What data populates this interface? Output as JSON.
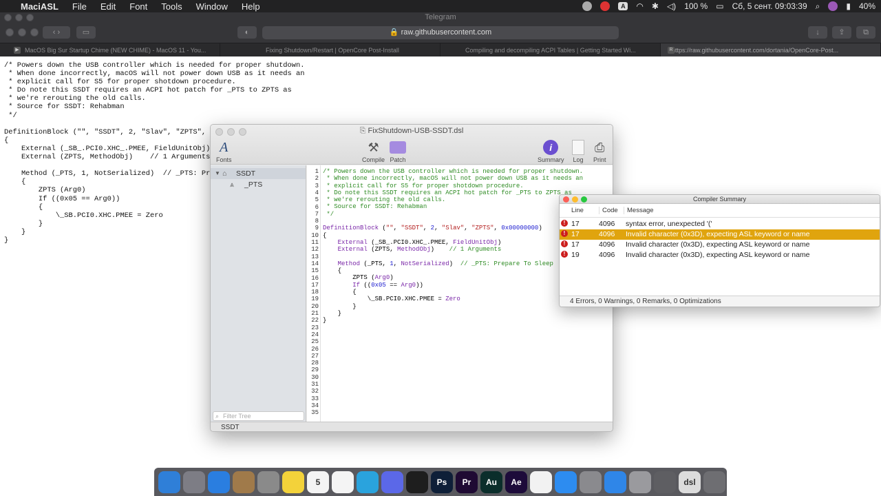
{
  "menubar": {
    "app": "MaciASL",
    "items": [
      "File",
      "Edit",
      "Font",
      "Tools",
      "Window",
      "Help"
    ],
    "battery": "100 %",
    "datetime": "Сб, 5 сент.  09:03:39",
    "battery2": "40%",
    "notif_badge": "A"
  },
  "browser": {
    "window_title": "Telegram",
    "url": "raw.githubusercontent.com",
    "tabs": [
      "MacOS Big Sur Startup Chime (NEW CHIME) - MacOS 11 - You...",
      "Fixing Shutdown/Restart | OpenCore Post-Install",
      "Compiling and decompiling ACPI Tables | Getting Started Wi...",
      "https://raw.githubusercontent.com/dortania/OpenCore-Post..."
    ]
  },
  "page": {
    "source": "/* Powers down the USB controller which is needed for proper shutdown.\n * When done incorrectly, macOS will not power down USB as it needs an\n * explicit call for S5 for proper shotdown procedure.\n * Do note this SSDT requires an ACPI hot patch for _PTS to ZPTS as\n * we're rerouting the old calls.\n * Source for SSDT: Rehabman\n */\n\nDefinitionBlock (\"\", \"SSDT\", 2, \"Slav\", \"ZPTS\",\n{\n    External (_SB_.PCI0.XHC_.PMEE, FieldUnitObj)\n    External (ZPTS, MethodObj)    // 1 Arguments\n\n    Method (_PTS, 1, NotSerialized)  // _PTS: Pr\n    {\n        ZPTS (Arg0)\n        If ((0x05 == Arg0))\n        {\n            \\_SB.PCI0.XHC.PMEE = Zero\n        }\n    }\n}"
  },
  "maciasl": {
    "title": "FixShutdown-USB-SSDT.dsl",
    "toolbar": {
      "fonts": "Fonts",
      "compile": "Compile",
      "patch": "Patch",
      "summary": "Summary",
      "log": "Log",
      "print": "Print"
    },
    "tree": {
      "root": "SSDT",
      "child": "_PTS",
      "filter_placeholder": "Filter Tree"
    },
    "status": "SSDT",
    "line_numbers": [
      "1",
      "2",
      "3",
      "4",
      "5",
      "6",
      "7",
      "8",
      "9",
      "10",
      "11",
      "12",
      "13",
      "14",
      "15",
      "16",
      "17",
      "18",
      "19",
      "20",
      "21",
      "22",
      "23",
      "24",
      "25",
      "26",
      "27",
      "28",
      "29",
      "30",
      "31",
      "32",
      "33",
      "34",
      "35"
    ]
  },
  "compiler": {
    "title": "Compiler Summary",
    "headers": {
      "line": "Line",
      "code": "Code",
      "message": "Message"
    },
    "rows": [
      {
        "line": "17",
        "code": "4096",
        "message": "syntax error, unexpected '('"
      },
      {
        "line": "17",
        "code": "4096",
        "message": "Invalid character (0x3D), expecting ASL keyword or name"
      },
      {
        "line": "17",
        "code": "4096",
        "message": "Invalid character (0x3D), expecting ASL keyword or name"
      },
      {
        "line": "19",
        "code": "4096",
        "message": "Invalid character (0x3D), expecting ASL keyword or name"
      }
    ],
    "footer": "4 Errors, 0 Warnings, 0 Remarks, 0 Optimizations"
  },
  "dock": {
    "apps": [
      {
        "name": "Finder",
        "label": "",
        "color": "#2f7fd8"
      },
      {
        "name": "Launchpad",
        "label": "",
        "color": "#7d7d85"
      },
      {
        "name": "Safari",
        "label": "",
        "color": "#2a7ee0"
      },
      {
        "name": "Contacts",
        "label": "",
        "color": "#a07a4a"
      },
      {
        "name": "Screenshot",
        "label": "",
        "color": "#8a8a8a"
      },
      {
        "name": "Notes",
        "label": "",
        "color": "#f3d23a"
      },
      {
        "name": "Calendar",
        "label": "5",
        "color": "#f4f4f4"
      },
      {
        "name": "Reminders",
        "label": "",
        "color": "#f4f4f4"
      },
      {
        "name": "Telegram",
        "label": "",
        "color": "#2aa3dd"
      },
      {
        "name": "Discord",
        "label": "",
        "color": "#5b68e8"
      },
      {
        "name": "Figma",
        "label": "",
        "color": "#1e1e1e"
      },
      {
        "name": "Photoshop",
        "label": "Ps",
        "color": "#0e1f38"
      },
      {
        "name": "Premiere",
        "label": "Pr",
        "color": "#1f0a33"
      },
      {
        "name": "Audition",
        "label": "Au",
        "color": "#0b2e2b"
      },
      {
        "name": "After Effects",
        "label": "Ae",
        "color": "#1d0b3a"
      },
      {
        "name": "Music",
        "label": "",
        "color": "#f2f2f2"
      },
      {
        "name": "App Store",
        "label": "",
        "color": "#2d8cf0"
      },
      {
        "name": "System Preferences",
        "label": "",
        "color": "#8a8a8e"
      },
      {
        "name": "Shortcuts",
        "label": "",
        "color": "#2f86e8"
      },
      {
        "name": "Disk Utility",
        "label": "",
        "color": "#9a9a9e"
      },
      {
        "name": "MaciASL",
        "label": "",
        "color": "#5e5e62"
      },
      {
        "name": "Document",
        "label": "dsl",
        "color": "#dcdcdc"
      },
      {
        "name": "Trash",
        "label": "",
        "color": "#6e6e72"
      }
    ]
  }
}
